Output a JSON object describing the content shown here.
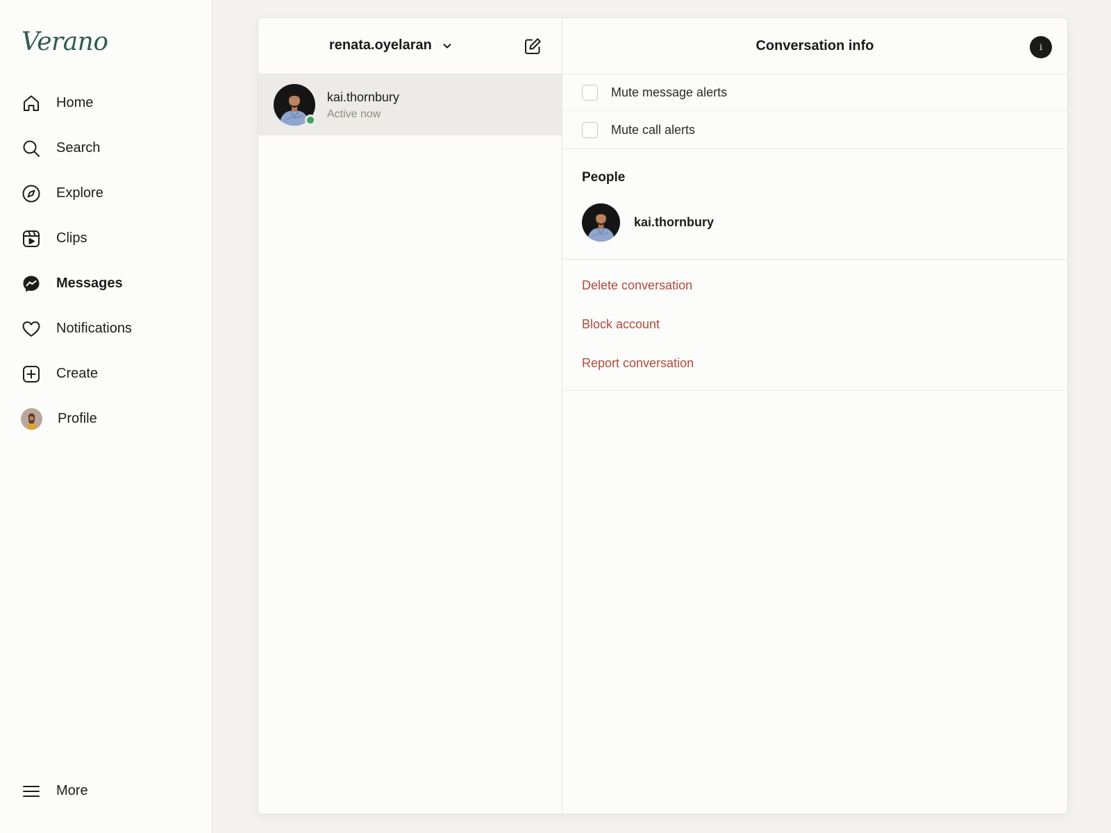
{
  "brand": {
    "name": "Verano",
    "color": "#2f5d4a"
  },
  "nav": {
    "items": [
      {
        "label": "Home",
        "icon": "home-icon"
      },
      {
        "label": "Search",
        "icon": "search-icon"
      },
      {
        "label": "Explore",
        "icon": "compass-icon"
      },
      {
        "label": "Clips",
        "icon": "clips-icon"
      },
      {
        "label": "Messages",
        "icon": "messenger-icon",
        "active": true
      },
      {
        "label": "Notifications",
        "icon": "heart-icon"
      },
      {
        "label": "Create",
        "icon": "plus-square-icon"
      },
      {
        "label": "Profile",
        "icon": "profile-avatar"
      }
    ],
    "more": {
      "label": "More",
      "icon": "menu-icon"
    }
  },
  "inbox": {
    "account": "renata.oyelaran",
    "threads": [
      {
        "name": "kai.thornbury",
        "status": "Active now",
        "online": true
      }
    ]
  },
  "info": {
    "title": "Conversation info",
    "toggle_glyph": "i",
    "mute_options": [
      {
        "label": "Mute message alerts",
        "checked": false
      },
      {
        "label": "Mute call alerts",
        "checked": false
      }
    ],
    "people_title": "People",
    "people": [
      {
        "name": "kai.thornbury"
      }
    ],
    "actions": [
      {
        "label": "Delete conversation"
      },
      {
        "label": "Block account"
      },
      {
        "label": "Report conversation"
      }
    ],
    "danger_color": "#b04a3a"
  }
}
